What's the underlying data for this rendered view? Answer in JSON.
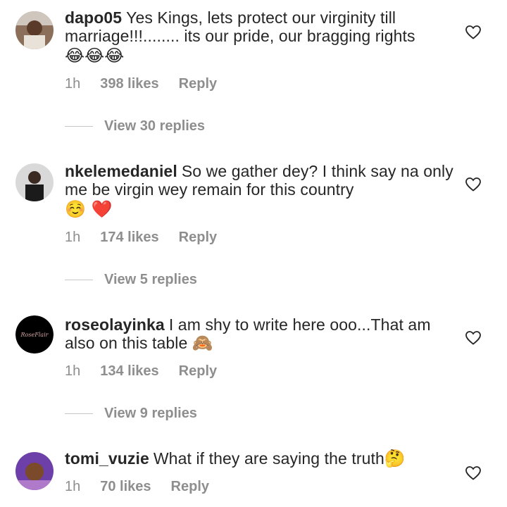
{
  "comments": [
    {
      "username": "dapo05",
      "text": "Yes Kings, lets protect our virginity till marriage!!!........ its our pride, our bragging rights",
      "emoji": "😂😂😂",
      "time": "1h",
      "likes": "398 likes",
      "reply": "Reply",
      "view_replies": "View 30 replies"
    },
    {
      "username": "nkelemedaniel",
      "text": "So we gather dey? I think say na only me be virgin wey remain for this country",
      "emoji": "☺️ ❤️",
      "time": "1h",
      "likes": "174 likes",
      "reply": "Reply",
      "view_replies": "View 5 replies"
    },
    {
      "username": "roseolayinka",
      "text": "I am shy to write here ooo...That am also on this table",
      "emoji": "🙈",
      "time": "1h",
      "likes": "134 likes",
      "reply": "Reply",
      "view_replies": "View 9 replies"
    },
    {
      "username": "tomi_vuzie",
      "text": "What if they are saying the truth",
      "emoji": "🤔",
      "time": "1h",
      "likes": "70 likes",
      "reply": "Reply"
    }
  ],
  "avatars": {
    "roseolayinka_logo_text": "RoseFlair"
  },
  "colors": {
    "text": "#262626",
    "muted": "#8e8e8e",
    "heart_outline": "#262626"
  },
  "icons": [
    "avatar",
    "heart-outline-icon"
  ]
}
